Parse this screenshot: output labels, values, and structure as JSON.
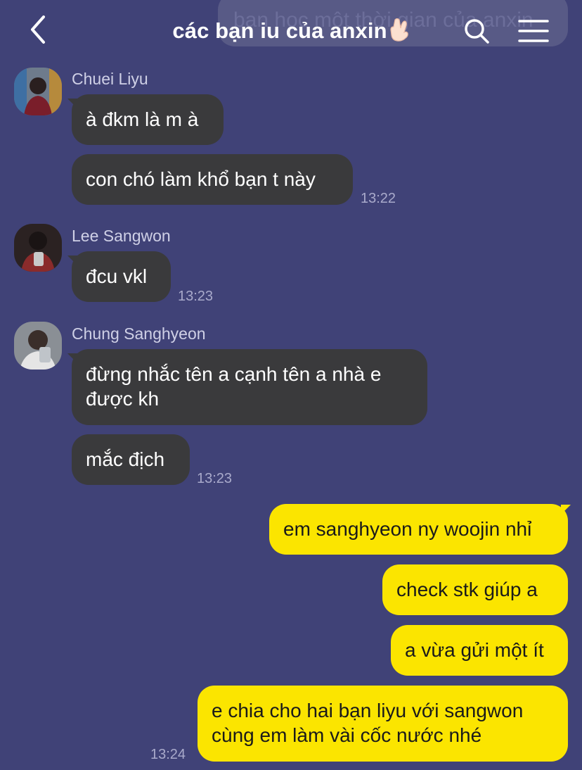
{
  "header": {
    "title": "các bạn iu của anxin",
    "back_icon": "chevron-left-icon",
    "search_icon": "search-icon",
    "menu_icon": "hamburger-menu-icon",
    "title_emoji": "crossed-fingers-emoji"
  },
  "notice": {
    "text": "bạn học một thời gian của anxin"
  },
  "messages": [
    {
      "sender": "Chuei Liyu",
      "bubbles": [
        "à đkm là m à",
        "con chó làm khổ bạn t này"
      ],
      "time": "13:22"
    },
    {
      "sender": "Lee Sangwon",
      "bubbles": [
        "đcu vkl"
      ],
      "time": "13:23"
    },
    {
      "sender": "Chung Sanghyeon",
      "bubbles": [
        "đừng nhắc tên a cạnh tên a nhà e",
        "được kh",
        "mắc địch"
      ],
      "time": "13:23"
    }
  ],
  "my_messages": {
    "bubbles": [
      "em sanghyeon ny woojin nhỉ",
      "check stk giúp a",
      "a vừa gửi một ít",
      "e chia cho hai bạn liyu với sangwon",
      "cùng em làm vài cốc nước nhé"
    ],
    "time": "13:24"
  },
  "colors": {
    "background": "#404277",
    "incoming_bubble": "#3a3a3c",
    "outgoing_bubble": "#fbe500"
  }
}
